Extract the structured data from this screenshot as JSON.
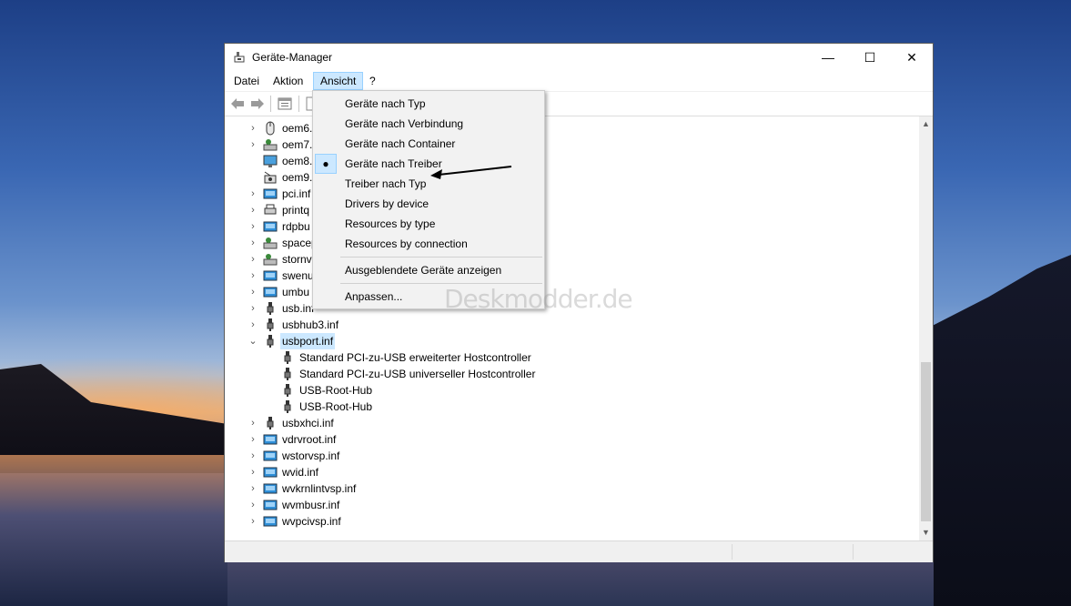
{
  "window": {
    "title": "Geräte-Manager",
    "minimize": "—",
    "maximize": "☐",
    "close": "✕"
  },
  "menu": [
    {
      "label": "Datei"
    },
    {
      "label": "Aktion"
    },
    {
      "label": "Ansicht"
    },
    {
      "label": "?"
    }
  ],
  "dropdown": {
    "items": [
      {
        "label": "Geräte nach Typ"
      },
      {
        "label": "Geräte nach Verbindung"
      },
      {
        "label": "Geräte nach Container"
      },
      {
        "label": "Geräte nach Treiber",
        "checked": "●"
      },
      {
        "label": "Treiber nach Typ"
      },
      {
        "label": "Drivers by device"
      },
      {
        "label": "Resources by type"
      },
      {
        "label": "Resources by connection"
      },
      {
        "label": "Ausgeblendete Geräte anzeigen"
      },
      {
        "label": "Anpassen..."
      }
    ]
  },
  "tree": {
    "rows": [
      {
        "label": "oem6.",
        "icon": "mouse-icon"
      },
      {
        "label": "oem7.",
        "icon": "device-icon"
      },
      {
        "label": "oem8.",
        "icon": "monitor-icon"
      },
      {
        "label": "oem9.",
        "icon": "camera-icon"
      },
      {
        "label": "pci.inf",
        "icon": "system-device-icon"
      },
      {
        "label": "printq",
        "icon": "printer-icon"
      },
      {
        "label": "rdpbu",
        "icon": "system-device-icon"
      },
      {
        "label": "spacep",
        "icon": "device-icon"
      },
      {
        "label": "stornv",
        "icon": "device-icon"
      },
      {
        "label": "swenu",
        "icon": "system-device-icon"
      },
      {
        "label": "umbu",
        "icon": "system-device-icon"
      },
      {
        "label": "usb.inf",
        "icon": "usb-icon"
      },
      {
        "label": "usbhub3.inf",
        "icon": "usb-icon"
      },
      {
        "label": "usbport.inf",
        "icon": "usb-icon"
      },
      {
        "label": "Standard PCI-zu-USB erweiterter Hostcontroller",
        "icon": "usb-icon"
      },
      {
        "label": "Standard PCI-zu-USB universeller Hostcontroller",
        "icon": "usb-icon"
      },
      {
        "label": "USB-Root-Hub",
        "icon": "usb-icon"
      },
      {
        "label": "USB-Root-Hub",
        "icon": "usb-icon"
      },
      {
        "label": "usbxhci.inf",
        "icon": "usb-icon"
      },
      {
        "label": "vdrvroot.inf",
        "icon": "system-device-icon"
      },
      {
        "label": "wstorvsp.inf",
        "icon": "system-device-icon"
      },
      {
        "label": "wvid.inf",
        "icon": "system-device-icon"
      },
      {
        "label": "wvkrnlintvsp.inf",
        "icon": "system-device-icon"
      },
      {
        "label": "wvmbusr.inf",
        "icon": "system-device-icon"
      },
      {
        "label": "wvpcivsp.inf",
        "icon": "system-device-icon"
      }
    ],
    "expander_collapsed": "›",
    "expander_expanded": "⌄"
  },
  "watermark": "Deskmodder.de",
  "colors": {
    "selection": "#cce8ff",
    "selection_border": "#99d1ff",
    "menu_bg": "#f2f2f2"
  }
}
